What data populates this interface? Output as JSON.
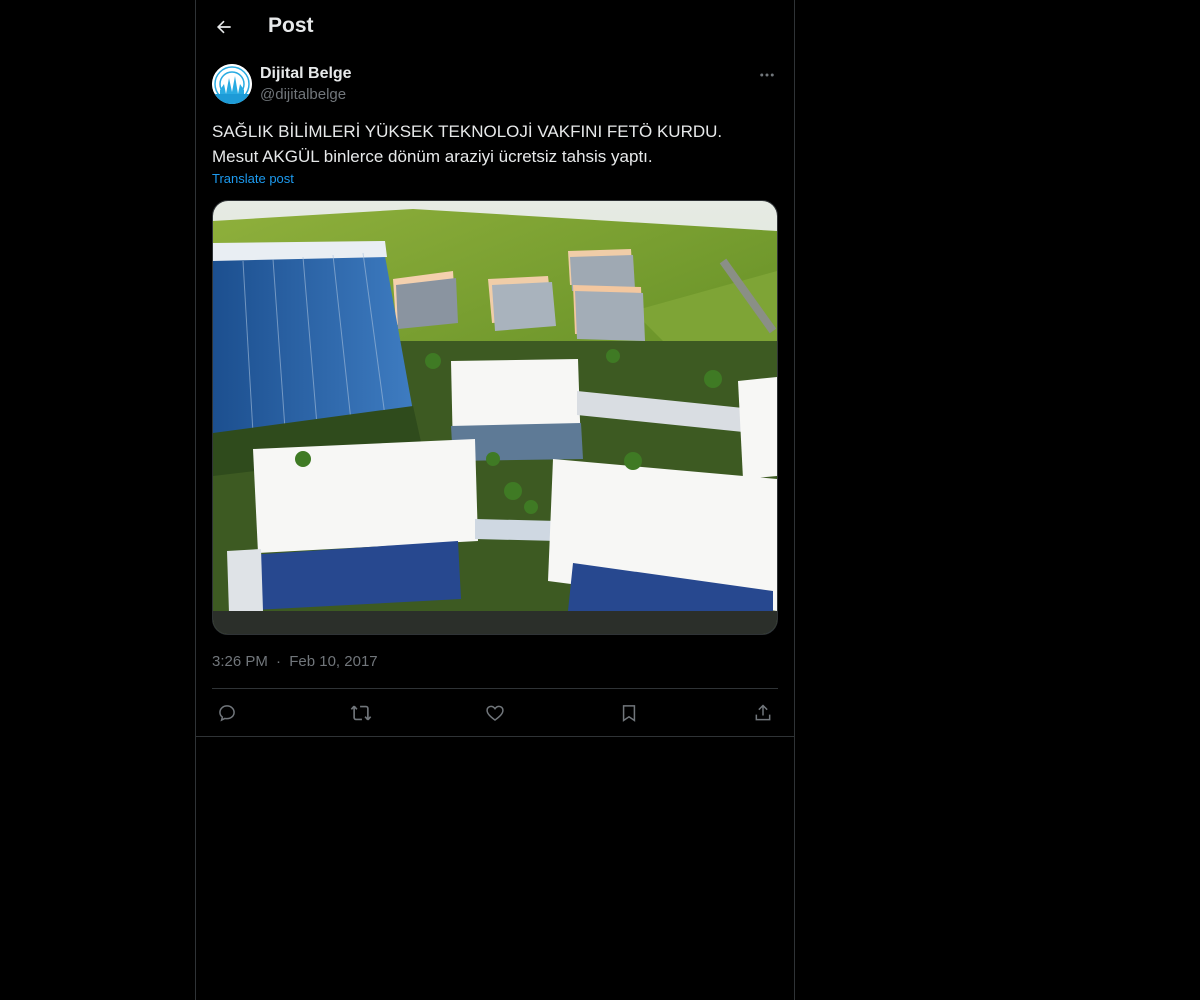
{
  "header": {
    "title": "Post",
    "back_icon": "arrow-left-icon"
  },
  "tweet": {
    "author": {
      "display_name": "Dijital Belge",
      "handle": "@dijitalbelge",
      "avatar_icon": "dijitalbelge-logo"
    },
    "text": "SAĞLIK BİLİMLERİ YÜKSEK TEKNOLOJİ VAKFINI FETÖ KURDU. Mesut AKGÜL binlerce dönüm araziyi ücretsiz tahsis yaptı.",
    "translate_label": "Translate post",
    "media": {
      "type": "image",
      "subject": "3D rendering of a hospital and university campus"
    },
    "time": "3:26 PM",
    "separator": "·",
    "date": "Feb 10, 2017",
    "actions": [
      "reply-icon",
      "retweet-icon",
      "like-icon",
      "bookmark-icon",
      "share-icon"
    ]
  },
  "colors": {
    "background": "#000000",
    "text_primary": "#e7e9ea",
    "text_secondary": "#71767b",
    "accent": "#1d9bf0",
    "border": "#2f3336"
  }
}
